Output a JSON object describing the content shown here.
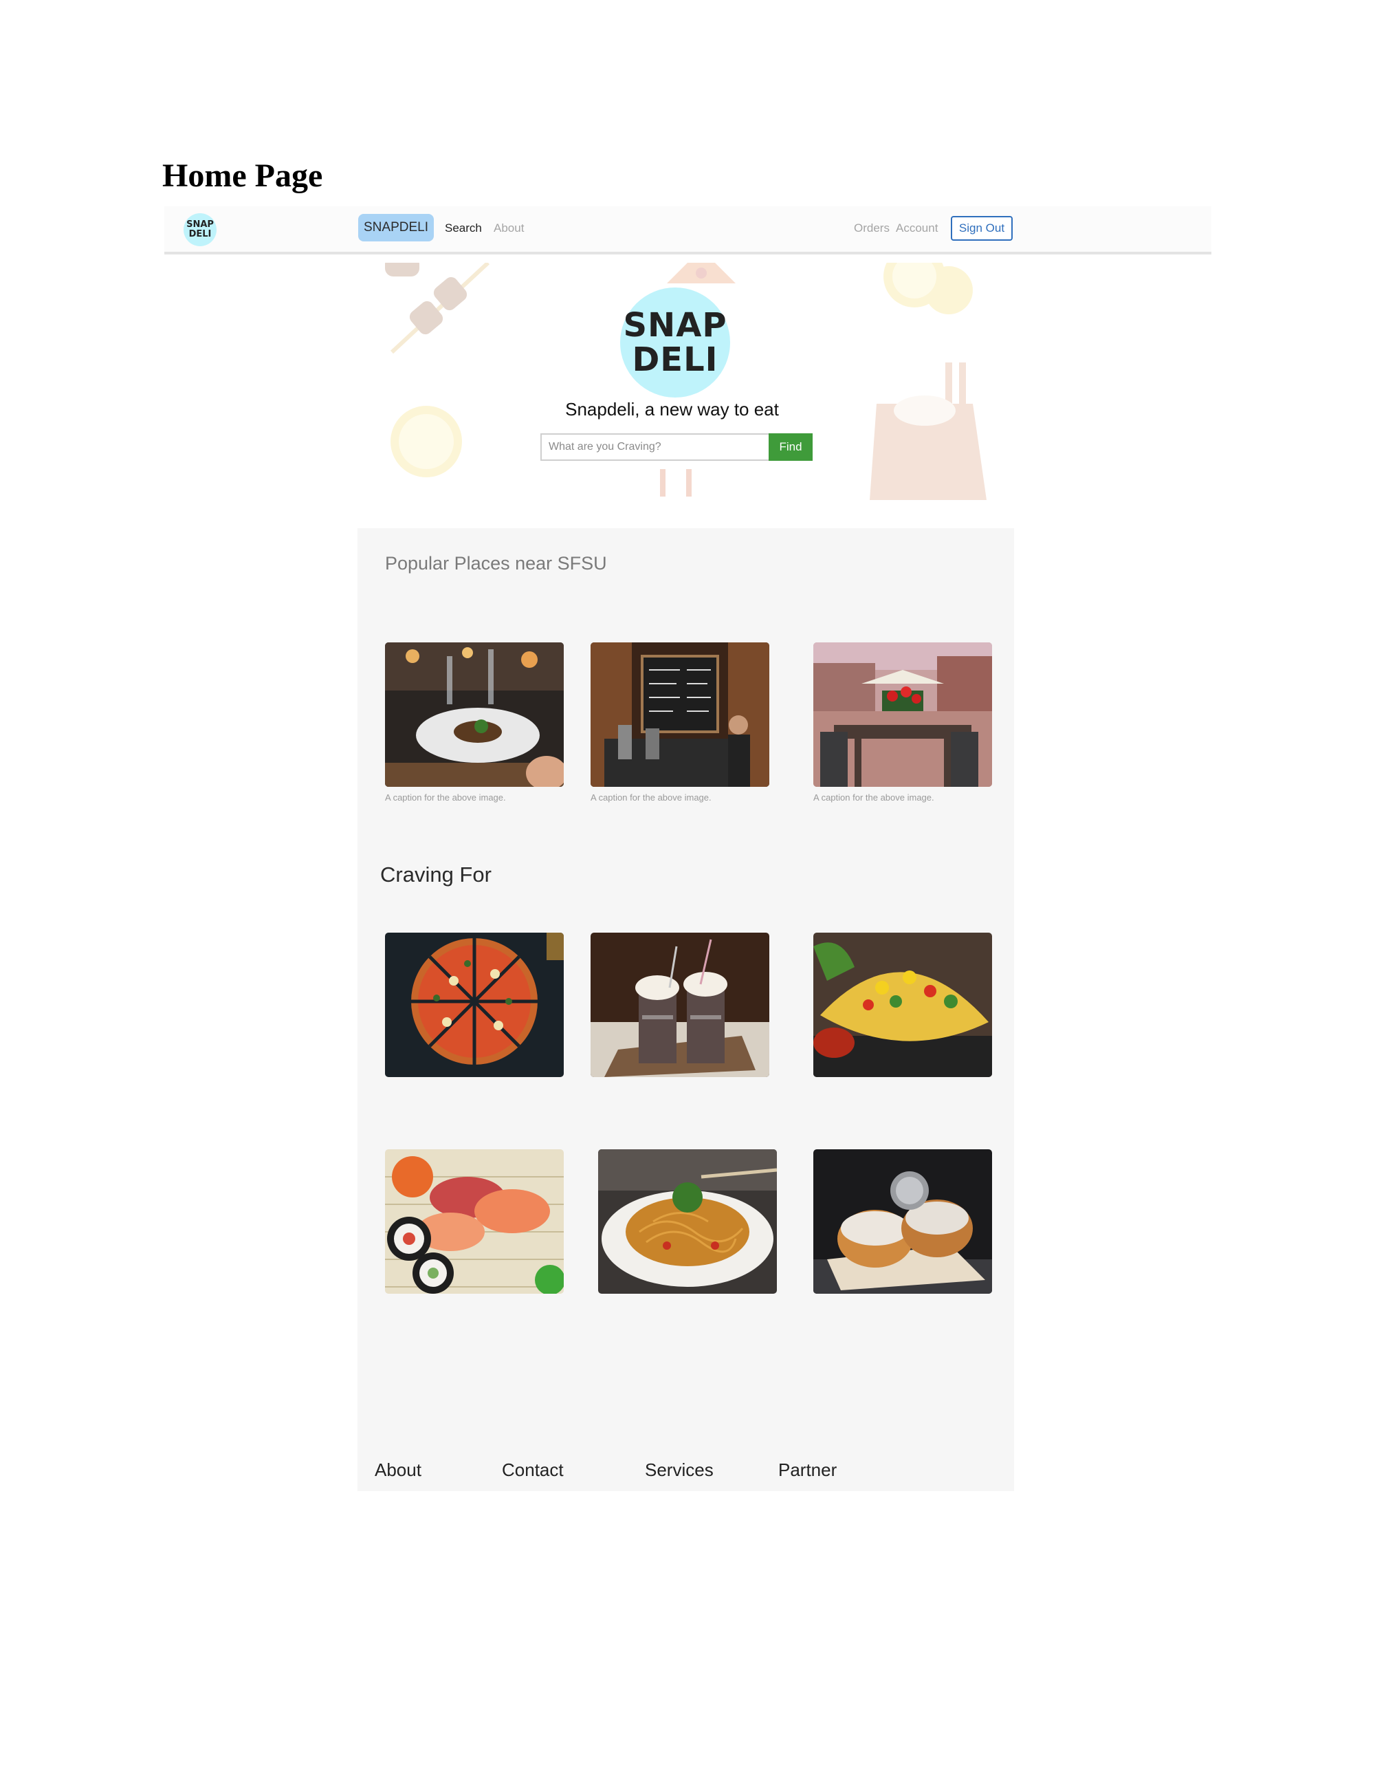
{
  "doc": {
    "heading": "Home Page"
  },
  "navbar": {
    "logo_line1": "SNAP",
    "logo_line2": "DELI",
    "brand": "SNAPDELI",
    "links": {
      "search": "Search",
      "about": "About",
      "orders": "Orders",
      "account": "Account"
    },
    "signout": "Sign Out"
  },
  "hero": {
    "logo_line1": "SNAP",
    "logo_line2": "DELI",
    "tagline": "Snapdeli, a new way to eat",
    "search_placeholder": "What are you Craving?",
    "find_label": "Find"
  },
  "popular": {
    "title": "Popular Places near SFSU",
    "places": [
      {
        "image": "restaurant-table-photo",
        "caption": "A caption for the above image."
      },
      {
        "image": "cafe-counter-photo",
        "caption": "A caption for the above image."
      },
      {
        "image": "patio-dining-photo",
        "caption": "A caption for the above image."
      }
    ]
  },
  "craving": {
    "title": "Craving For",
    "items": [
      "pizza-photo",
      "milkshakes-photo",
      "tacos-photo",
      "sushi-photo",
      "noodles-photo",
      "donuts-photo"
    ]
  },
  "footer": {
    "about": "About",
    "contact": "Contact",
    "services": "Services",
    "partner": "Partner"
  },
  "colors": {
    "logo_bg": "#bff3fb",
    "brand_bg": "#a9d3f5",
    "find_green": "#3f9b3a",
    "signout_blue": "#2f6fbd",
    "panel_bg": "#f6f6f6"
  }
}
